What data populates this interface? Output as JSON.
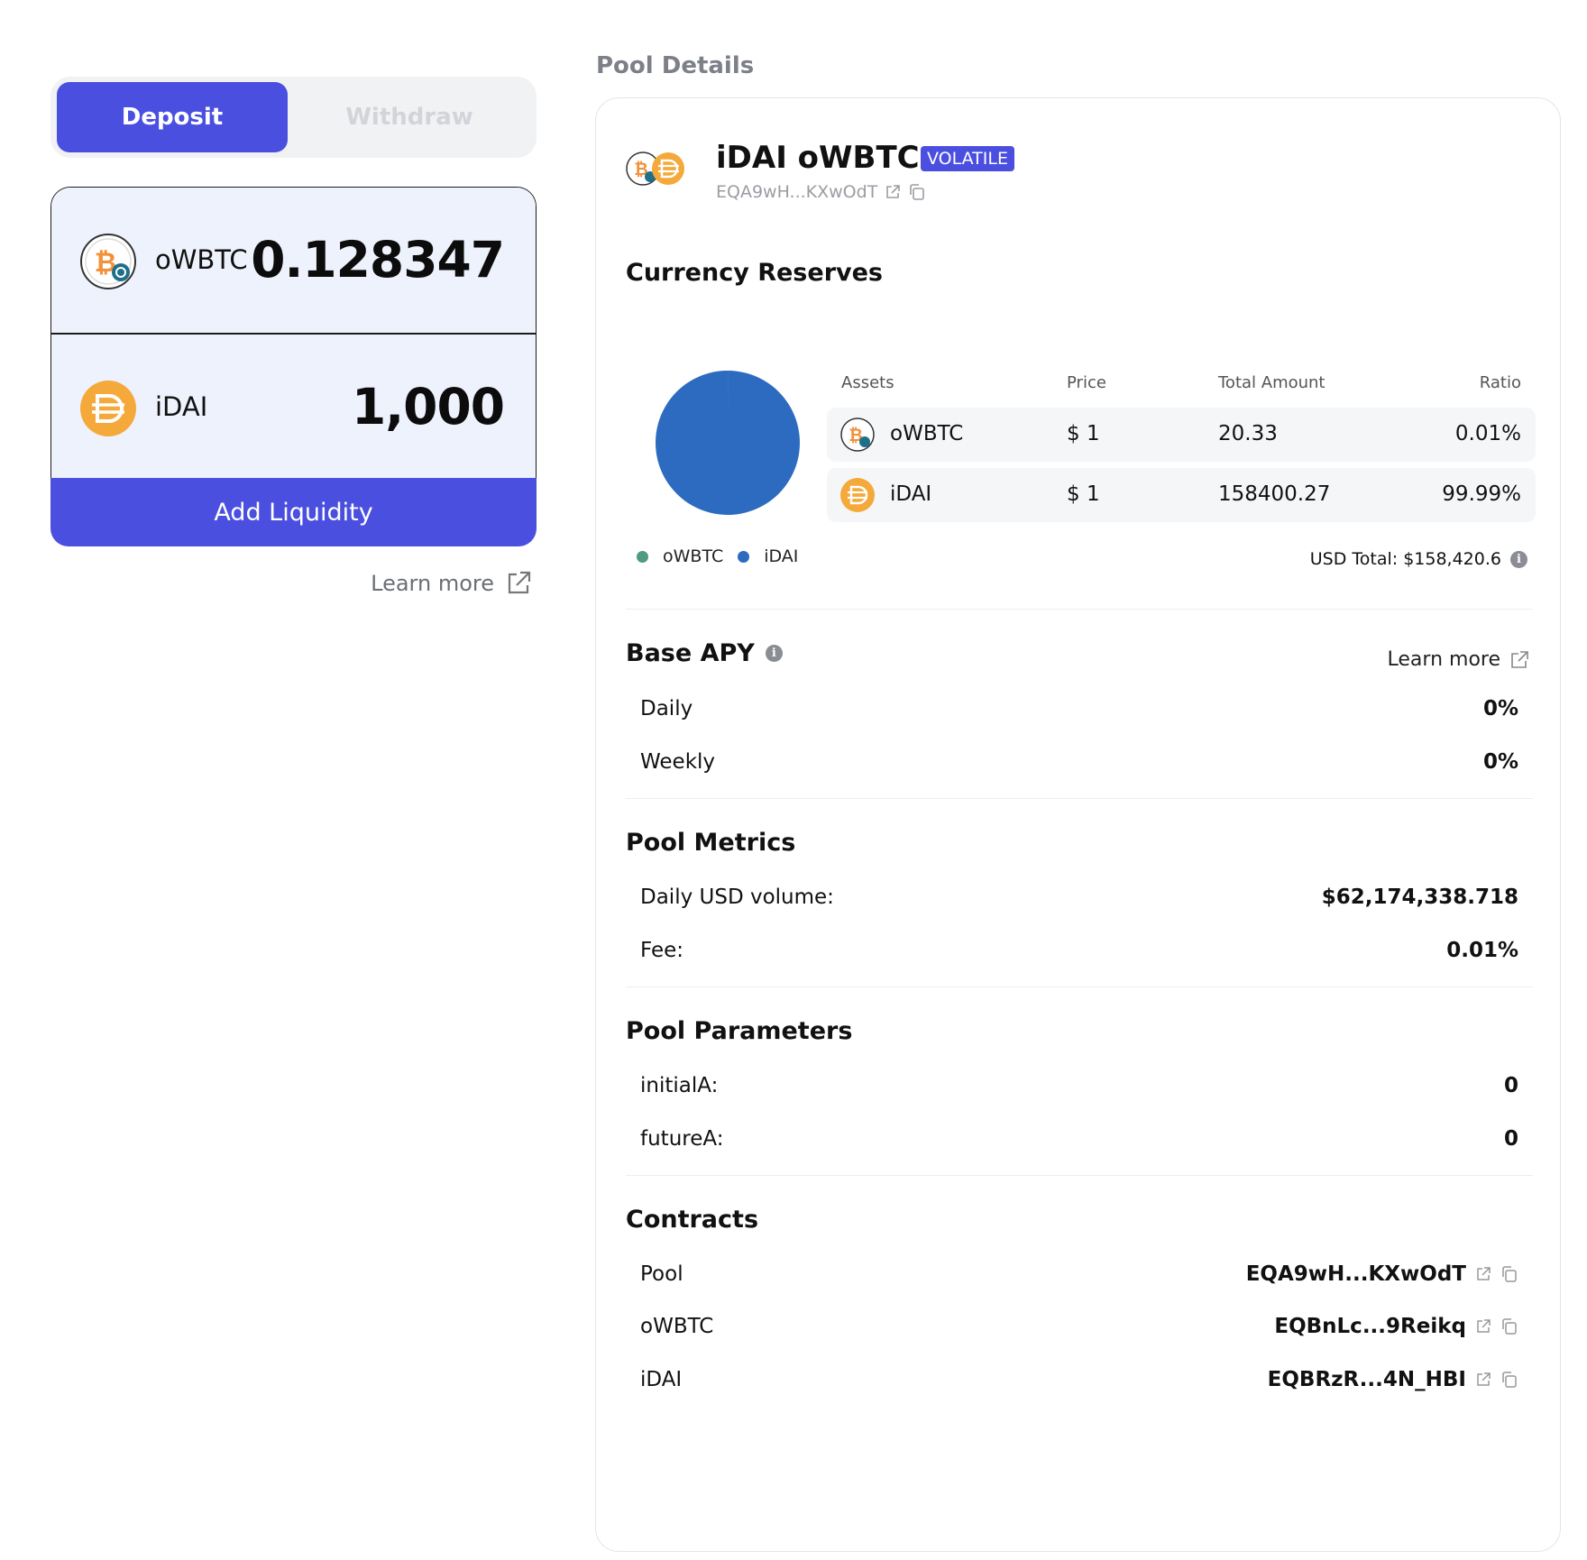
{
  "tabs": {
    "deposit": "Deposit",
    "withdraw": "Withdraw"
  },
  "inputs": [
    {
      "symbol": "oWBTC",
      "amount": "0.128347",
      "icon": "bitcoin-icon"
    },
    {
      "symbol": "iDAI",
      "amount": "1,000",
      "icon": "dai-icon"
    }
  ],
  "add_liquidity": "Add Liquidity",
  "learn_more": "Learn more",
  "pool_details": {
    "heading": "Pool Details",
    "name": "iDAI oWBTC",
    "badge": "VOLATILE",
    "address": "EQA9wH...KXwOdT",
    "reserves": {
      "title": "Currency Reserves",
      "headers": {
        "assets": "Assets",
        "price": "Price",
        "total": "Total Amount",
        "ratio": "Ratio"
      },
      "rows": [
        {
          "asset": "oWBTC",
          "price": "$ 1",
          "total": "20.33",
          "ratio": "0.01%"
        },
        {
          "asset": "iDAI",
          "price": "$ 1",
          "total": "158400.27",
          "ratio": "99.99%"
        }
      ],
      "legend": [
        "oWBTC",
        "iDAI"
      ],
      "usd_total": "USD Total: $158,420.6"
    },
    "apy": {
      "title": "Base APY",
      "learn_more": "Learn more",
      "daily_label": "Daily",
      "daily_value": "0%",
      "weekly_label": "Weekly",
      "weekly_value": "0%"
    },
    "metrics": {
      "title": "Pool Metrics",
      "volume_label": "Daily USD volume:",
      "volume_value": "$62,174,338.718",
      "fee_label": "Fee:",
      "fee_value": "0.01%"
    },
    "parameters": {
      "title": "Pool Parameters",
      "initialA_label": "initialA:",
      "initialA_value": "0",
      "futureA_label": "futureA:",
      "futureA_value": "0"
    },
    "contracts": {
      "title": "Contracts",
      "pool_label": "Pool",
      "pool_value": "EQA9wH...KXwOdT",
      "owbtc_label": "oWBTC",
      "owbtc_value": "EQBnLc...9Reikq",
      "idai_label": "iDAI",
      "idai_value": "EQBRzR...4N_HBI"
    }
  },
  "colors": {
    "accent": "#4a4fe0",
    "pie_owbtc": "#4f9a80",
    "pie_idai": "#2c6bbf",
    "btc_orange": "#f2913a",
    "dai_orange": "#f4a93a"
  },
  "chart_data": {
    "type": "pie",
    "labels": [
      "oWBTC",
      "iDAI"
    ],
    "values": [
      0.01,
      99.99
    ]
  }
}
